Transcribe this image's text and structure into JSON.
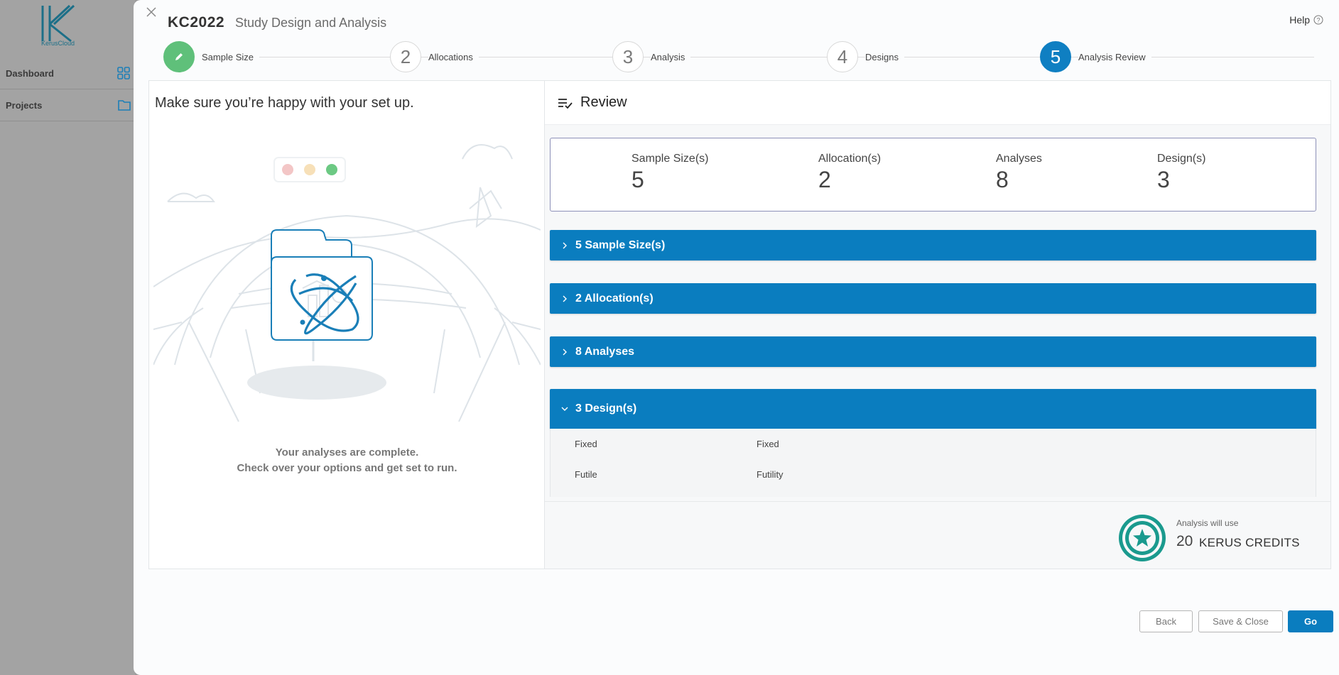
{
  "background_app": {
    "logo_text": "KerusCloud",
    "nav": [
      {
        "label": "Dashboard",
        "icon": "grid-icon"
      },
      {
        "label": "Projects",
        "icon": "folder-icon"
      }
    ]
  },
  "header": {
    "code": "KC2022",
    "subtitle": "Study Design and Analysis",
    "help_label": "Help"
  },
  "stepper": {
    "steps": [
      {
        "number": "",
        "label": "Sample Size",
        "state": "done"
      },
      {
        "number": "2",
        "label": "Allocations",
        "state": "pending"
      },
      {
        "number": "3",
        "label": "Analysis",
        "state": "pending"
      },
      {
        "number": "4",
        "label": "Designs",
        "state": "pending"
      },
      {
        "number": "5",
        "label": "Analysis Review",
        "state": "active"
      }
    ]
  },
  "left": {
    "title": "Make sure you’re happy with your set up.",
    "message_line1": "Your analyses are complete.",
    "message_line2": "Check over your options and get set to run."
  },
  "review": {
    "title": "Review",
    "summary": [
      {
        "label": "Sample Size(s)",
        "value": "5"
      },
      {
        "label": "Allocation(s)",
        "value": "2"
      },
      {
        "label": "Analyses",
        "value": "8"
      },
      {
        "label": "Design(s)",
        "value": "3"
      }
    ],
    "sections": [
      {
        "label": "5 Sample Size(s)",
        "expanded": false
      },
      {
        "label": "2 Allocation(s)",
        "expanded": false
      },
      {
        "label": "8 Analyses",
        "expanded": false
      },
      {
        "label": "3 Design(s)",
        "expanded": true
      }
    ],
    "design_rows": [
      {
        "name": "Fixed",
        "value": "Fixed"
      },
      {
        "name": "Futile",
        "value": "Futility"
      }
    ],
    "credits": {
      "label": "Analysis will use",
      "amount": "20",
      "unit": "KERUS CREDITS"
    }
  },
  "footer": {
    "back_label": "Back",
    "save_label": "Save & Close",
    "go_label": "Go"
  },
  "colors": {
    "primary": "#0a7dbf",
    "success": "#5fc07a",
    "teal": "#1a9a8e"
  }
}
